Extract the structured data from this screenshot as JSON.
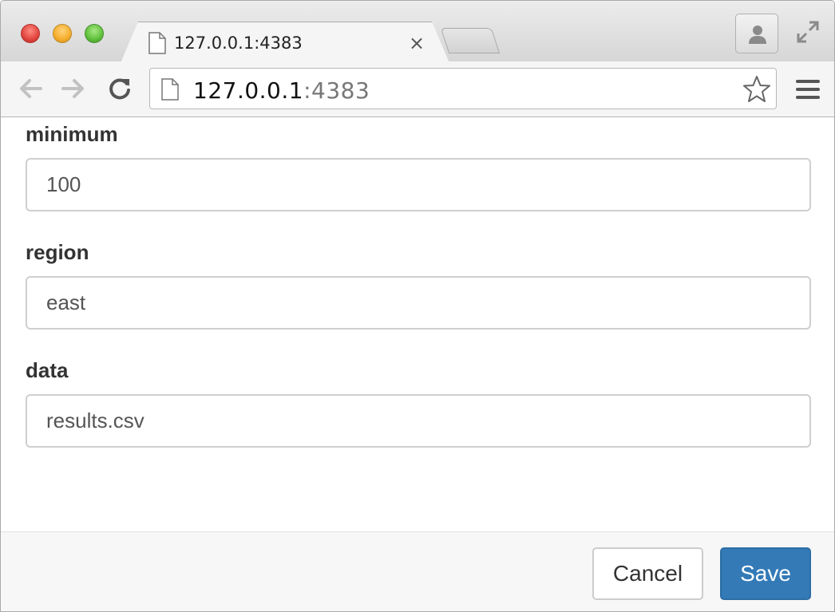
{
  "browser": {
    "tab": {
      "title": "127.0.0.1:4383",
      "close_glyph": "×"
    },
    "address": {
      "host": "127.0.0.1",
      "port": ":4383"
    },
    "icons": {
      "page": "page-icon",
      "back": "back-arrow-icon",
      "forward": "forward-arrow-icon",
      "reload": "reload-icon",
      "bookmark": "star-icon",
      "menu": "hamburger-menu-icon",
      "profile": "person-icon",
      "fullscreen": "fullscreen-icon"
    }
  },
  "form": {
    "fields": [
      {
        "label": "minimum",
        "value": "100"
      },
      {
        "label": "region",
        "value": "east"
      },
      {
        "label": "data",
        "value": "results.csv"
      }
    ]
  },
  "footer": {
    "cancel_label": "Cancel",
    "save_label": "Save"
  },
  "colors": {
    "primary": "#337ab7",
    "label_text": "#333333",
    "input_text": "#555555"
  }
}
